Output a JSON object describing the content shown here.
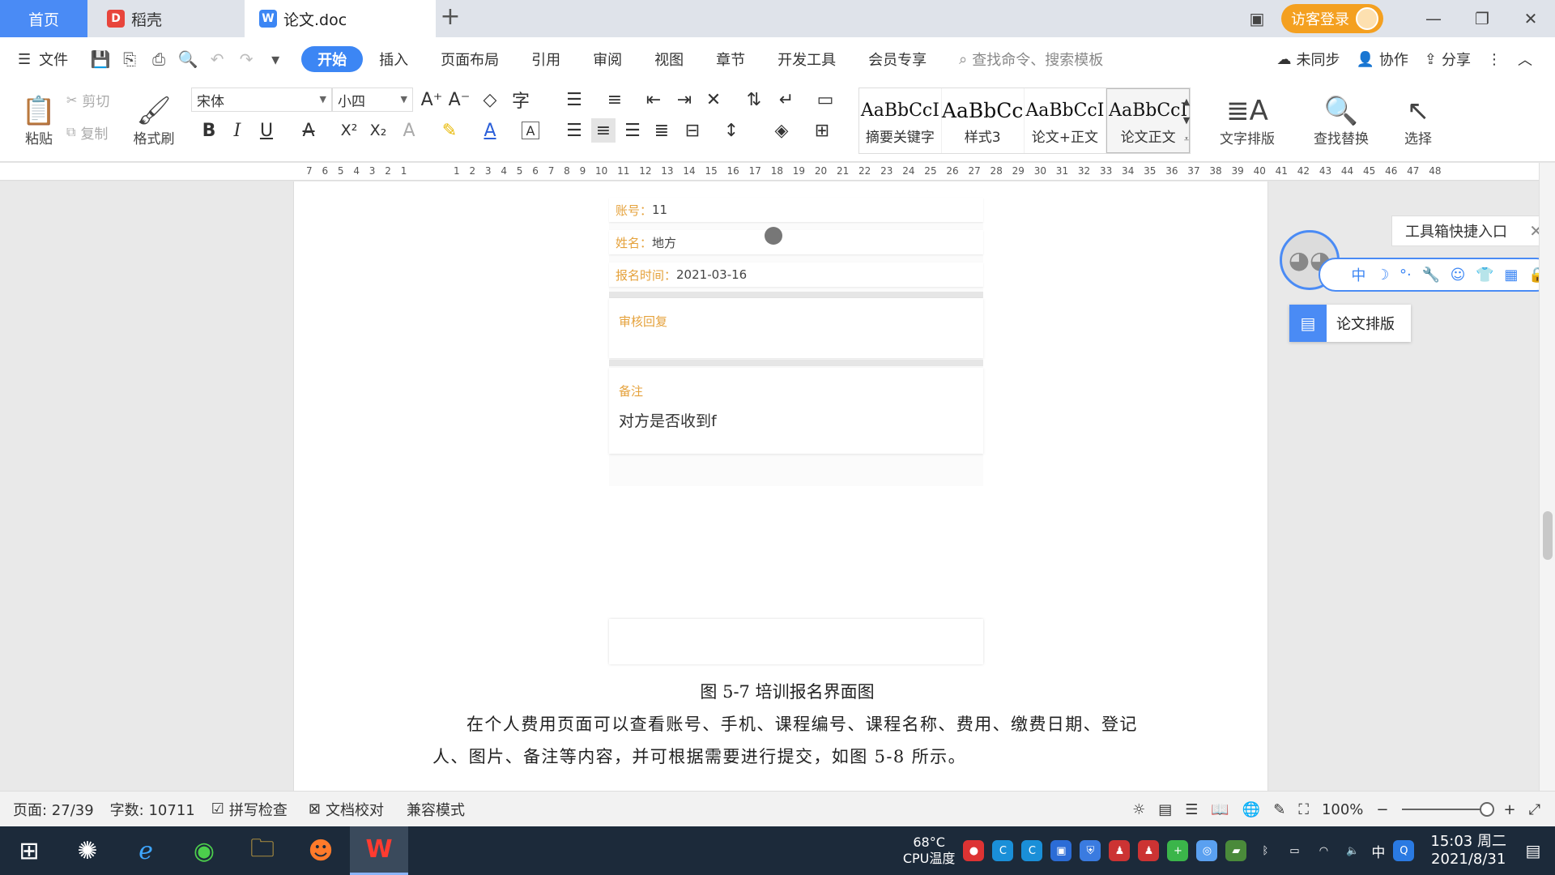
{
  "tabs": {
    "home": "首页",
    "daoke": "稻壳",
    "doc": "论文.doc",
    "add": "+"
  },
  "window": {
    "visitor_login": "访客登录",
    "minimize": "—",
    "restore": "❐",
    "close": "✕"
  },
  "menu": {
    "file": "文件",
    "tabs": [
      "开始",
      "插入",
      "页面布局",
      "引用",
      "审阅",
      "视图",
      "章节",
      "开发工具",
      "会员专享"
    ],
    "search_placeholder": "查找命令、搜索模板",
    "unsync": "未同步",
    "collab": "协作",
    "share": "分享"
  },
  "ribbon": {
    "paste": "粘贴",
    "cut": "剪切",
    "copy": "复制",
    "format_painter": "格式刷",
    "font_name": "宋体",
    "font_size": "小四",
    "styles": [
      {
        "sample": "AaBbCcI",
        "name": "摘要关键字"
      },
      {
        "sample": "AaBbCc",
        "name": "样式3"
      },
      {
        "sample": "AaBbCcI",
        "name": "论文+正文"
      },
      {
        "sample": "AaBbCcI",
        "name": "论文正文"
      }
    ],
    "text_layout": "文字排版",
    "find_replace": "查找替换",
    "select": "选择"
  },
  "ruler": {
    "left_marks": "7 6 5 4 3 2 1",
    "right_marks": "1 2 3 4 5 6 7 8 9 10 11 12 13 14 15 16 17 18 19 20 21 22 23 24 25 26 27 28 29 30 31 32 33 34 35 36 37 38 39 40 41 42 43 44 45 46 47 48"
  },
  "document": {
    "screenshot": {
      "account_label": "账号：",
      "account_value": "11",
      "name_label": "姓名：",
      "name_value": "地方",
      "time_label": "报名时间：",
      "time_value": "2021-03-16",
      "review_label": "审核回复",
      "note_label": "备注",
      "note_value": "对方是否收到f"
    },
    "caption": "图 5-7 培训报名界面图",
    "paragraph": "在个人费用页面可以查看账号、手机、课程编号、课程名称、费用、缴费日期、登记人、图片、备注等内容，并可根据需要进行提交，如图 5-8 所示。"
  },
  "floating": {
    "toolbox_entry": "工具箱快捷入口",
    "toolbar_icons": [
      "中",
      "☽",
      "°·",
      "🔧",
      "☺",
      "👕",
      "▦",
      "🔒"
    ],
    "paper_layout": "论文排版"
  },
  "status": {
    "page": "页面: 27/39",
    "words": "字数: 10711",
    "spell_check": "拼写检查",
    "doc_proof": "文档校对",
    "compat_mode": "兼容模式",
    "zoom": "100%"
  },
  "taskbar": {
    "cpu_temp": "68°C",
    "cpu_label": "CPU温度",
    "ime": "中",
    "time": "15:03 周二",
    "date": "2021/8/31"
  }
}
